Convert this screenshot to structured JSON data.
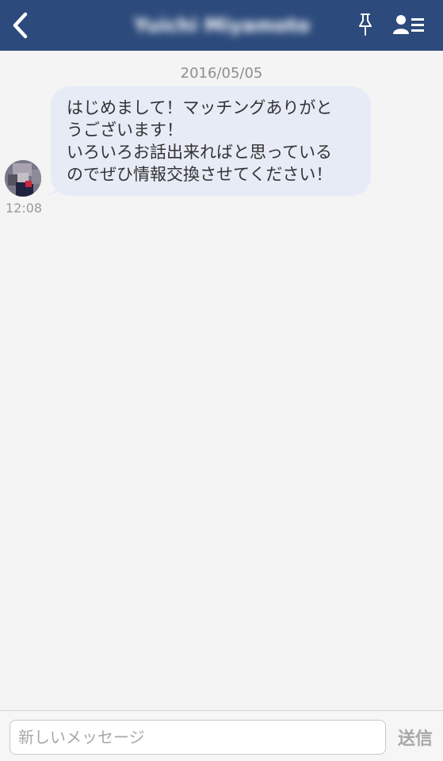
{
  "header": {
    "title": "Yuichi Miyamoto",
    "back_icon": "chevron-left-icon",
    "pin_icon": "pin-icon",
    "contact_icon": "contact-list-icon",
    "background_color": "#2c4a7c"
  },
  "chat": {
    "date": "2016/05/05",
    "messages": [
      {
        "direction": "incoming",
        "lines": [
          "はじめまして！マッチングありがと",
          "うございます！",
          "いろいろお話出来ればと思っている",
          "のでぜひ情報交換させてください！"
        ],
        "time": "12:08",
        "bubble_color": "#e6ebf6"
      }
    ]
  },
  "composer": {
    "placeholder": "新しいメッセージ",
    "value": "",
    "send_label": "送信"
  }
}
